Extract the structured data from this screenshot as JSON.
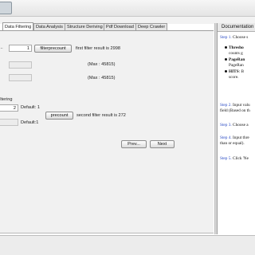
{
  "tabs": [
    "Data Filtering",
    "Data Analysis",
    "Structure Deriving",
    "Pdf Download",
    "Deep Crawler"
  ],
  "active_tab": 0,
  "filter1": {
    "prefix": "...",
    "value": "1",
    "button": "filterprecount",
    "result": "first filter result is 2998"
  },
  "max_row_1": "(Max : 45815)",
  "max_row_2": "(Max : 45815)",
  "filter2": {
    "section": "iltering",
    "value": "2",
    "default_label": "Default: 1",
    "button": "precount",
    "result": "second filter result is 272",
    "default2": "Default:1"
  },
  "nav": {
    "prev": "Prev...",
    "next": "Next"
  },
  "doc": {
    "header": "Documentation",
    "step1": "Step 1.",
    "step1_text": "Choose s",
    "b1": "Thresho",
    "b1_sub": "counts g",
    "b2": "PageRan",
    "b2_sub": "PageRan",
    "b3": "HITS",
    "b3_text": ": B",
    "b3_sub": "score.",
    "step2": "Step 2.",
    "step2_text": "Input valu",
    "step2_sub": "field (Based on th",
    "step3": "Step 3.",
    "step3_text": "Choose a",
    "step4": "Step 4.",
    "step4_text": "Input thre",
    "step4_sub": "than or equal).",
    "step5": "Step 5.",
    "step5_text": "Click 'Ne"
  }
}
